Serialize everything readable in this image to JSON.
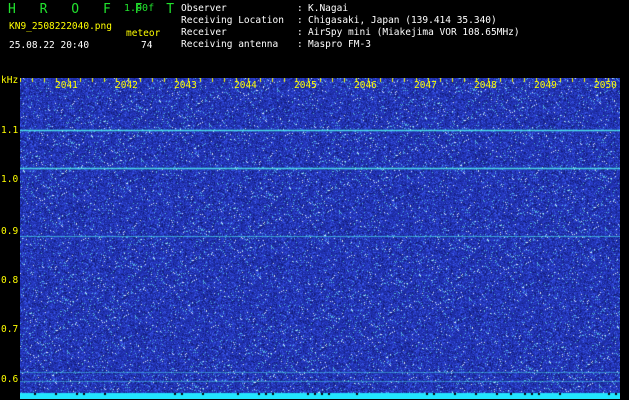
{
  "header": {
    "brand": "H R O F F T",
    "version": "1.00f",
    "filename": "KN9_2508222040.png",
    "datetime": "25.08.22 20:40",
    "meteor_label": "meteor",
    "meteor_count": "74"
  },
  "info": [
    {
      "label": "Observer",
      "value": "K.Nagai"
    },
    {
      "label": "Receiving Location",
      "value": "Chigasaki, Japan (139.414 35.340)"
    },
    {
      "label": "Receiver",
      "value": "AirSpy mini (Miakejima VOR 108.65MHz)"
    },
    {
      "label": "Receiving antenna",
      "value": "Maspro FM-3"
    }
  ],
  "axis": {
    "y_unit": "kHz",
    "y_ticks": [
      "1.1",
      "1.0",
      "0.9",
      "0.8",
      "0.7",
      "0.6"
    ],
    "x_ticks": [
      "2041",
      "2042",
      "2043",
      "2044",
      "2045",
      "2046",
      "2047",
      "2048",
      "2049",
      "2050"
    ]
  },
  "colors": {
    "background": "#1e2ea6",
    "noise": "#4a6af0",
    "signal_line": "#4ff0f0",
    "baseline": "#22e6ff",
    "label": "#ffff00"
  }
}
